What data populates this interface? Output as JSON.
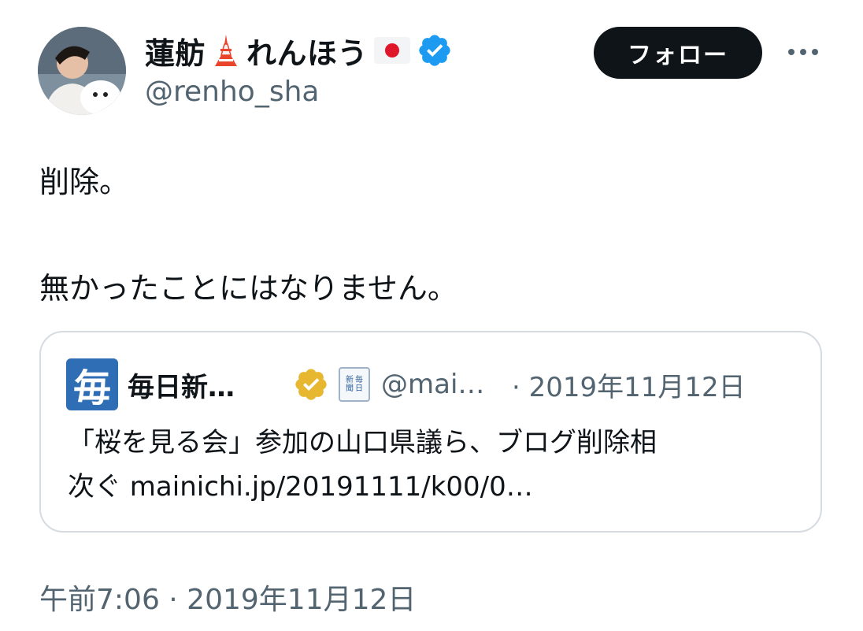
{
  "author": {
    "display_name": "蓮舫",
    "display_name_2": "れんほう",
    "handle": "@renho_sha"
  },
  "actions": {
    "follow_label": "フォロー"
  },
  "tweet": {
    "line1": "削除。",
    "line2": "無かったことにはなりません。"
  },
  "quoted": {
    "logo_char": "毎",
    "name": "毎日新…",
    "mini_icon_text": [
      "新",
      "毎",
      "聞",
      "日"
    ],
    "handle": "@mai…",
    "date": "· 2019年11月12日",
    "text_line1": "「桜を見る会」参加の山口県議ら、ブログ削除相",
    "text_line2": "次ぐ mainichi.jp/20191111/k00/0…"
  },
  "footer": {
    "timestamp": "午前7:06 · 2019年11月12日"
  },
  "colors": {
    "verified_blue": "#1d9bf0",
    "verified_gold": "#e8b730",
    "secondary_text": "#536471",
    "follow_bg": "#0f1419"
  }
}
